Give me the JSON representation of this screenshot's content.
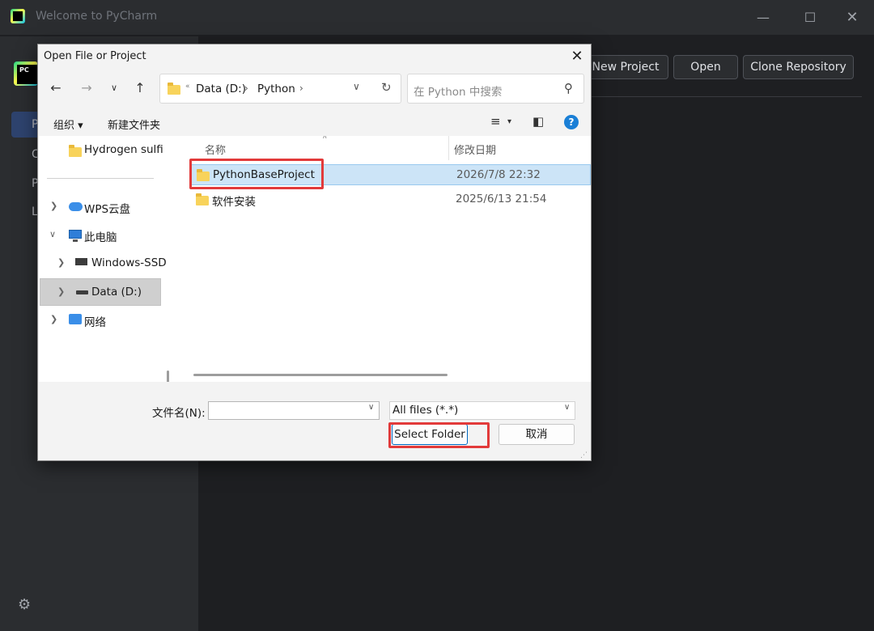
{
  "pycharm": {
    "window_title": "Welcome to PyCharm",
    "sidebar_items": [
      "P",
      "C",
      "P",
      "L"
    ],
    "buttons": {
      "new_project": "New Project",
      "open": "Open",
      "clone": "Clone Repository"
    }
  },
  "dialog": {
    "title": "Open File or Project",
    "address": {
      "overflow": "«",
      "segments": [
        "Data (D:)",
        "Python"
      ]
    },
    "search_placeholder": "在 Python 中搜索",
    "toolbar": {
      "organize": "组织 ▾",
      "new_folder": "新建文件夹"
    },
    "tree": {
      "items": [
        {
          "label": "Hydrogen sulfi"
        },
        {
          "label": "WPS云盘"
        },
        {
          "label": "此电脑"
        },
        {
          "label": "Windows-SSD"
        },
        {
          "label": "Data (D:)"
        },
        {
          "label": "网络"
        }
      ]
    },
    "columns": {
      "name": "名称",
      "modified": "修改日期"
    },
    "files": [
      {
        "name": "PythonBaseProject",
        "date": "2026/7/8 22:32"
      },
      {
        "name": "软件安装",
        "date": "2025/6/13 21:54"
      }
    ],
    "filename_label": "文件名(N):",
    "filename_value": "",
    "filter": "All files (*.*)",
    "buttons": {
      "select_folder": "Select Folder",
      "cancel": "取消"
    }
  },
  "colors": {
    "accent_red": "#e23a3a",
    "selection_blue": "#cce4f7",
    "ide_bg": "#1e1f22"
  }
}
